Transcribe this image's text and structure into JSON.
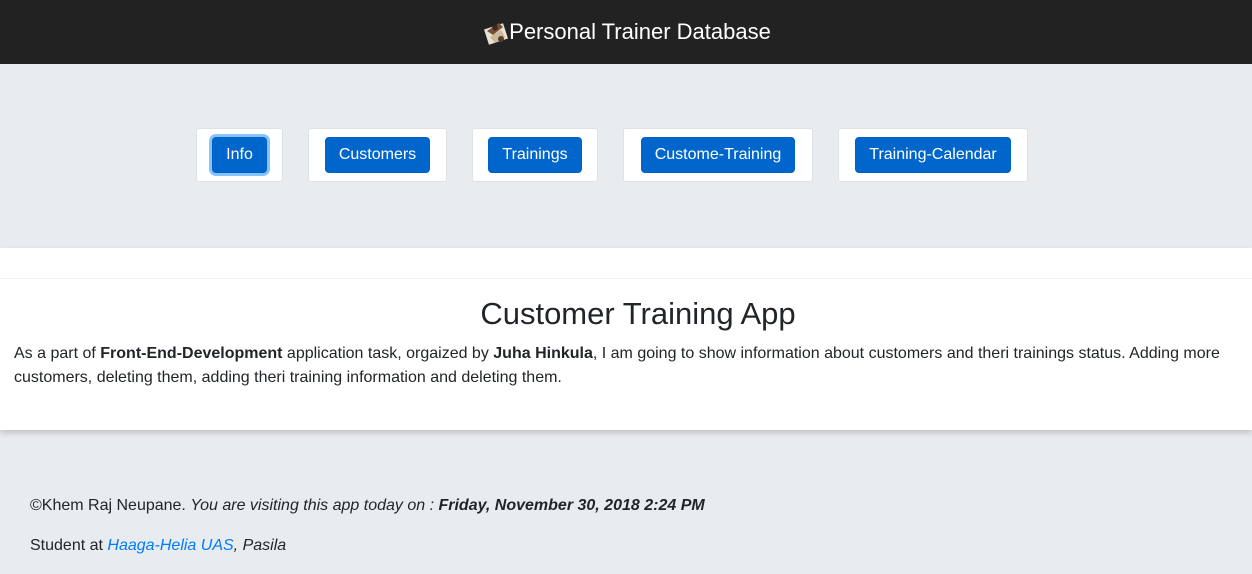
{
  "header": {
    "title": "Personal Trainer Database",
    "logo_icon": "trainer-logo-icon"
  },
  "nav": {
    "buttons": [
      {
        "label": "Info",
        "active": true
      },
      {
        "label": "Customers",
        "active": false
      },
      {
        "label": "Trainings",
        "active": false
      },
      {
        "label": "Custome-Training",
        "active": false
      },
      {
        "label": "Training-Calendar",
        "active": false
      }
    ]
  },
  "main": {
    "title": "Customer Training App",
    "intro_prefix": "As a part of ",
    "course": "Front-End-Development",
    "intro_middle": " application task, orgaized by ",
    "teacher": "Juha Hinkula",
    "intro_suffix": ", I am going to show information about customers and theri trainings status. Adding more customers, deleting them, adding theri training information and deleting them."
  },
  "footer": {
    "copyright": "©Khem Raj Neupane. ",
    "visit_text": "You are visiting this app today on : ",
    "visit_date": "Friday, November 30, 2018 2:24 PM",
    "student_prefix": "Student at ",
    "school": "Haaga-Helia UAS",
    "campus": ", Pasila"
  },
  "colors": {
    "topbar": "#222222",
    "button": "#0066cc",
    "link": "#007bff",
    "page_background": "#e9ecef"
  }
}
